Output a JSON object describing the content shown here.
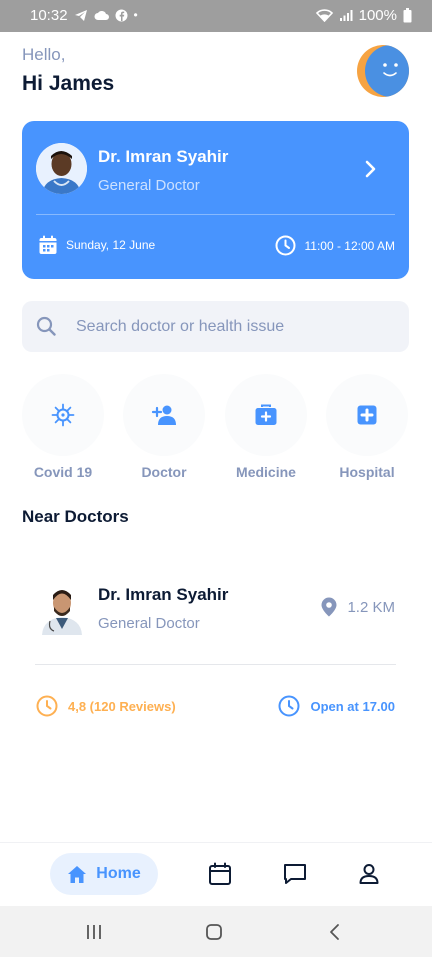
{
  "status_bar": {
    "time": "10:32",
    "battery": "100%",
    "icons": [
      "telegram-icon",
      "cloud-icon",
      "facebook-icon",
      "dot-icon",
      "wifi-icon",
      "signal-icon",
      "battery-icon"
    ]
  },
  "greeting": {
    "hello": "Hello,",
    "name": "Hi James"
  },
  "appointment": {
    "doctor_name": "Dr. Imran Syahir",
    "doctor_role": "General Doctor",
    "date": "Sunday, 12 June",
    "time": "11:00 - 12:00 AM"
  },
  "search": {
    "placeholder": "Search doctor or health issue"
  },
  "categories": [
    {
      "label": "Covid 19",
      "icon": "virus-icon"
    },
    {
      "label": "Doctor",
      "icon": "add-user-icon"
    },
    {
      "label": "Medicine",
      "icon": "medkit-icon"
    },
    {
      "label": "Hospital",
      "icon": "hospital-cross-icon"
    }
  ],
  "near_doctors": {
    "title": "Near Doctors",
    "items": [
      {
        "name": "Dr. Imran Syahir",
        "role": "General Doctor",
        "distance": "1.2 KM",
        "rating": "4,8 (120 Reviews)",
        "open": "Open at 17.00"
      }
    ]
  },
  "bottom_nav": {
    "home_label": "Home",
    "items": [
      "home-icon",
      "calendar-icon",
      "chat-icon",
      "profile-icon"
    ]
  },
  "colors": {
    "primary": "#4894fe",
    "text_dark": "#0d1b34",
    "text_muted": "#8696bb",
    "rating": "#feb052",
    "avatar_orange": "#f6a342"
  }
}
